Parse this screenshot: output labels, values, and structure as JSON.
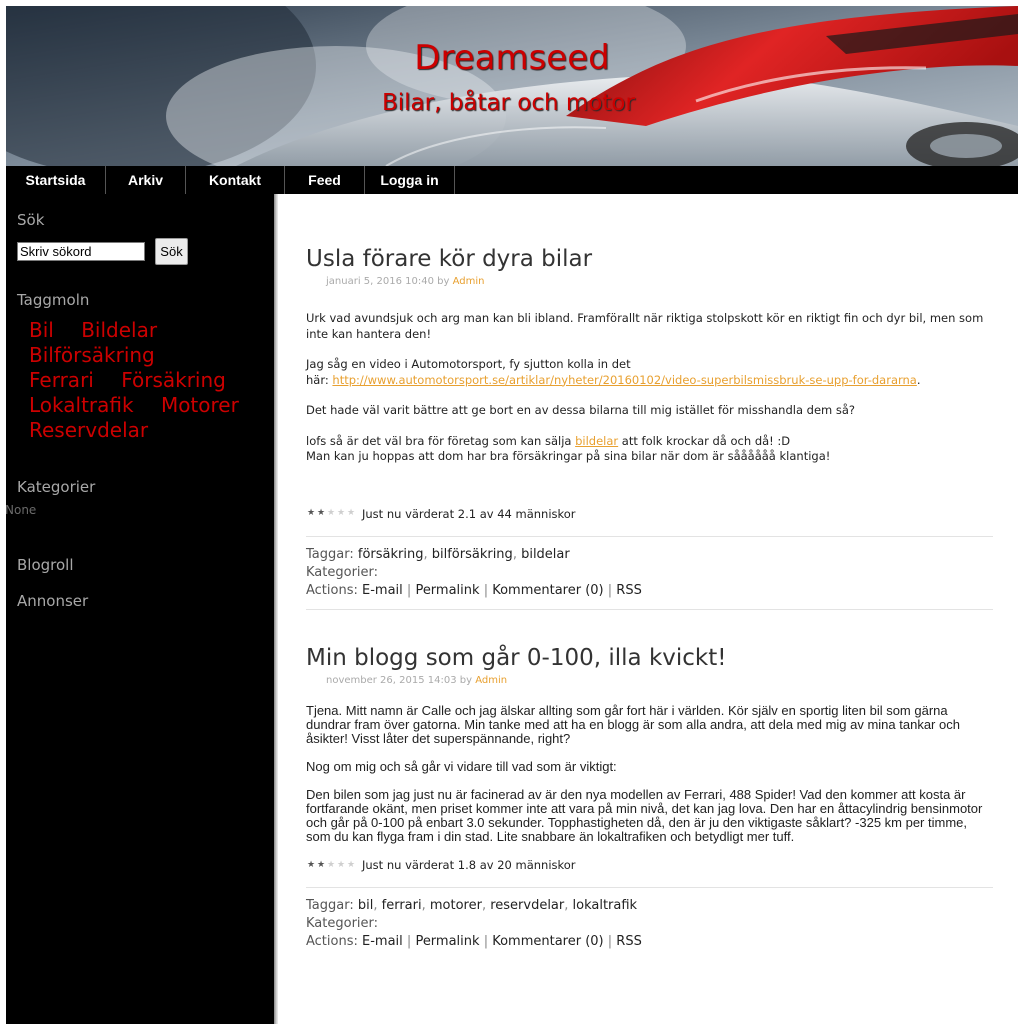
{
  "site": {
    "title": "Dreamseed",
    "tagline": "Bilar, båtar och motor"
  },
  "nav": [
    {
      "label": "Startsida"
    },
    {
      "label": "Arkiv"
    },
    {
      "label": "Kontakt"
    },
    {
      "label": "Feed"
    },
    {
      "label": "Logga in"
    }
  ],
  "sidebar": {
    "search_heading": "Sök",
    "search_value": "Skriv sökord",
    "search_button": "Sök",
    "tagcloud_heading": "Taggmoln",
    "tags": [
      "Bil",
      "Bildelar",
      "Bilförsäkring",
      "Ferrari",
      "Försäkring",
      "Lokaltrafik",
      "Motorer",
      "Reservdelar"
    ],
    "categories_heading": "Kategorier",
    "categories_empty": "None",
    "blogroll_heading": "Blogroll",
    "ads_heading": "Annonser"
  },
  "posts": [
    {
      "title": "Usla förare kör dyra bilar",
      "date": "januari 5, 2016 10:40",
      "by": "by",
      "author": "Admin",
      "p1": "Urk vad avundsjuk och arg man kan bli ibland. Framförallt när riktiga stolpskott kör en riktigt fin och dyr bil, men som inte kan hantera den!",
      "p2_line1": "Jag såg en video i Automotorsport, fy sjutton kolla in det",
      "p2_prefix": "här: ",
      "p2_link": "http://www.automotorsport.se/artiklar/nyheter/20160102/video-superbilsmissbruk-se-upp-for-dararna",
      "p2_suffix": ".",
      "p3": "Det hade väl varit bättre att ge bort en av dessa bilarna till mig istället för misshandla dem så?",
      "p4_prefix": "lofs så är det väl bra för företag som kan sälja ",
      "p4_link": "bildelar",
      "p4_suffix": " att folk krockar då och då! :D",
      "p4_line2": "Man kan ju hoppas att dom har bra försäkringar på sina bilar när dom är såååååå klantiga!",
      "rating_value": 2.1,
      "rating_text": "Just nu värderat 2.1 av 44 människor",
      "tags_label": "Taggar:",
      "tags": [
        "försäkring",
        "bilförsäkring",
        "bildelar"
      ],
      "categories_label": "Kategorier:",
      "actions_label": "Actions:",
      "actions": [
        "E-mail",
        "Permalink",
        "Kommentarer (0)",
        "RSS"
      ]
    },
    {
      "title": "Min blogg som går 0-100, illa kvickt!",
      "date": "november 26, 2015 14:03",
      "by": "by",
      "author": "Admin",
      "p1": "Tjena. Mitt namn är Calle och jag älskar allting som går fort här i världen. Kör själv en sportig liten bil som gärna dundrar fram över gatorna. Min tanke med att ha en blogg är som alla andra, att dela med mig av mina tankar och åsikter! Visst låter det superspännande, right?",
      "p2": "Nog om mig och så går vi vidare till vad som är viktigt:",
      "p3": "Den bilen som jag just nu är facinerad av är den nya modellen av Ferrari, 488 Spider! Vad den kommer att kosta är fortfarande okänt, men priset kommer inte att vara på min nivå, det kan jag lova. Den har en åttacylindrig bensinmotor och går på 0-100 på enbart 3.0 sekunder. Topphastigheten då, den är ju den viktigaste såklart? -325 km per timme, som du kan flyga fram i din stad. Lite snabbare än lokaltrafiken och betydligt mer tuff.",
      "rating_value": 1.8,
      "rating_text": "Just nu värderat 1.8 av 20 människor",
      "tags_label": "Taggar:",
      "tags": [
        "bil",
        "ferrari",
        "motorer",
        "reservdelar",
        "lokaltrafik"
      ],
      "categories_label": "Kategorier:",
      "actions_label": "Actions:",
      "actions": [
        "E-mail",
        "Permalink",
        "Kommentarer (0)",
        "RSS"
      ]
    }
  ],
  "colors": {
    "accent_red": "#cc0000",
    "link_orange": "#e8a030",
    "sidebar_bg": "#000000"
  }
}
